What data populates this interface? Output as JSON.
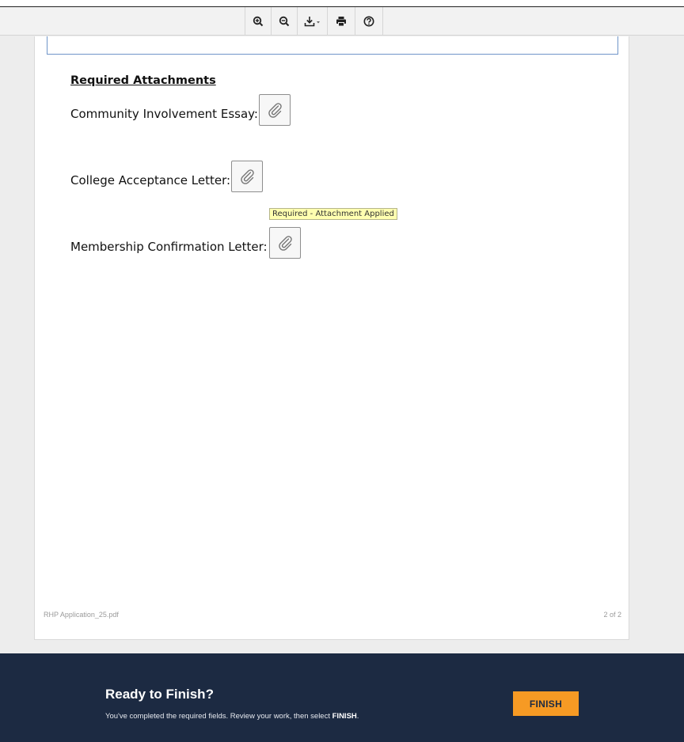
{
  "toolbar": {
    "buttons": [
      {
        "name": "zoom-in",
        "icon": "zoom-in-icon"
      },
      {
        "name": "zoom-out",
        "icon": "zoom-out-icon"
      },
      {
        "name": "download",
        "icon": "download-icon"
      },
      {
        "name": "print",
        "icon": "print-icon"
      },
      {
        "name": "help",
        "icon": "help-icon"
      }
    ]
  },
  "document": {
    "section_title": "Required Attachments",
    "attachments": [
      {
        "label": "Community Involvement Essay:",
        "icon": "paperclip-icon"
      },
      {
        "label": "College Acceptance Letter:",
        "icon": "paperclip-icon"
      },
      {
        "label": "Membership Confirmation Letter:",
        "icon": "paperclip-icon"
      }
    ],
    "tooltip": "Required - Attachment Applied"
  },
  "footer": {
    "filename": "RHP Application_25.pdf",
    "page_indicator": "2 of 2"
  },
  "finish_bar": {
    "title": "Ready to Finish?",
    "description_prefix": "You've completed the required fields. Review your work, then select ",
    "description_emphasis": "FINISH",
    "description_suffix": ".",
    "button_label": "FINISH",
    "background_color": "#1c2a42",
    "button_color": "#f69a24"
  }
}
